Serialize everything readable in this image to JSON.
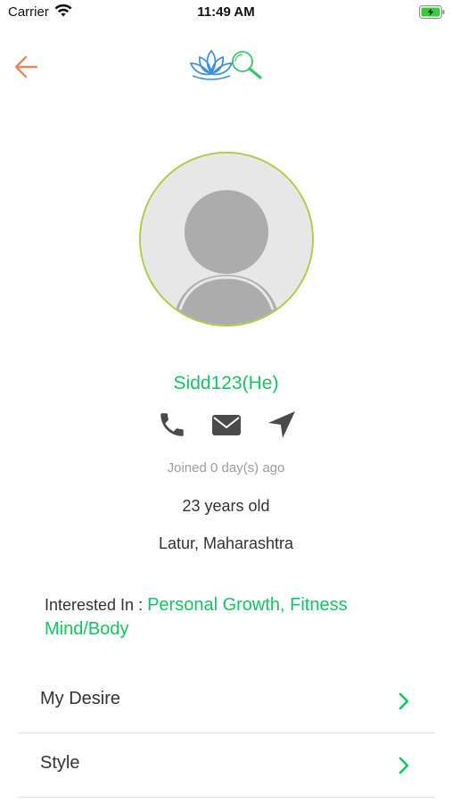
{
  "status_bar": {
    "carrier": "Carrier",
    "time": "11:49 AM"
  },
  "profile": {
    "username": "Sidd123(He)",
    "joined": "Joined 0 day(s) ago",
    "age": "23 years old",
    "location": "Latur, Maharashtra",
    "interested_label": "Interested In : ",
    "interested_value": "Personal Growth, Fitness Mind/Body"
  },
  "menu": [
    {
      "label": "My Desire"
    },
    {
      "label": "Style"
    }
  ],
  "colors": {
    "accent_green": "#16c263",
    "back_arrow": "#e8875a",
    "avatar_ring": "#a8cf45"
  },
  "icons": [
    "back-arrow-icon",
    "lotus-logo-icon",
    "phone-icon",
    "mail-icon",
    "location-arrow-icon",
    "chevron-right-icon"
  ]
}
